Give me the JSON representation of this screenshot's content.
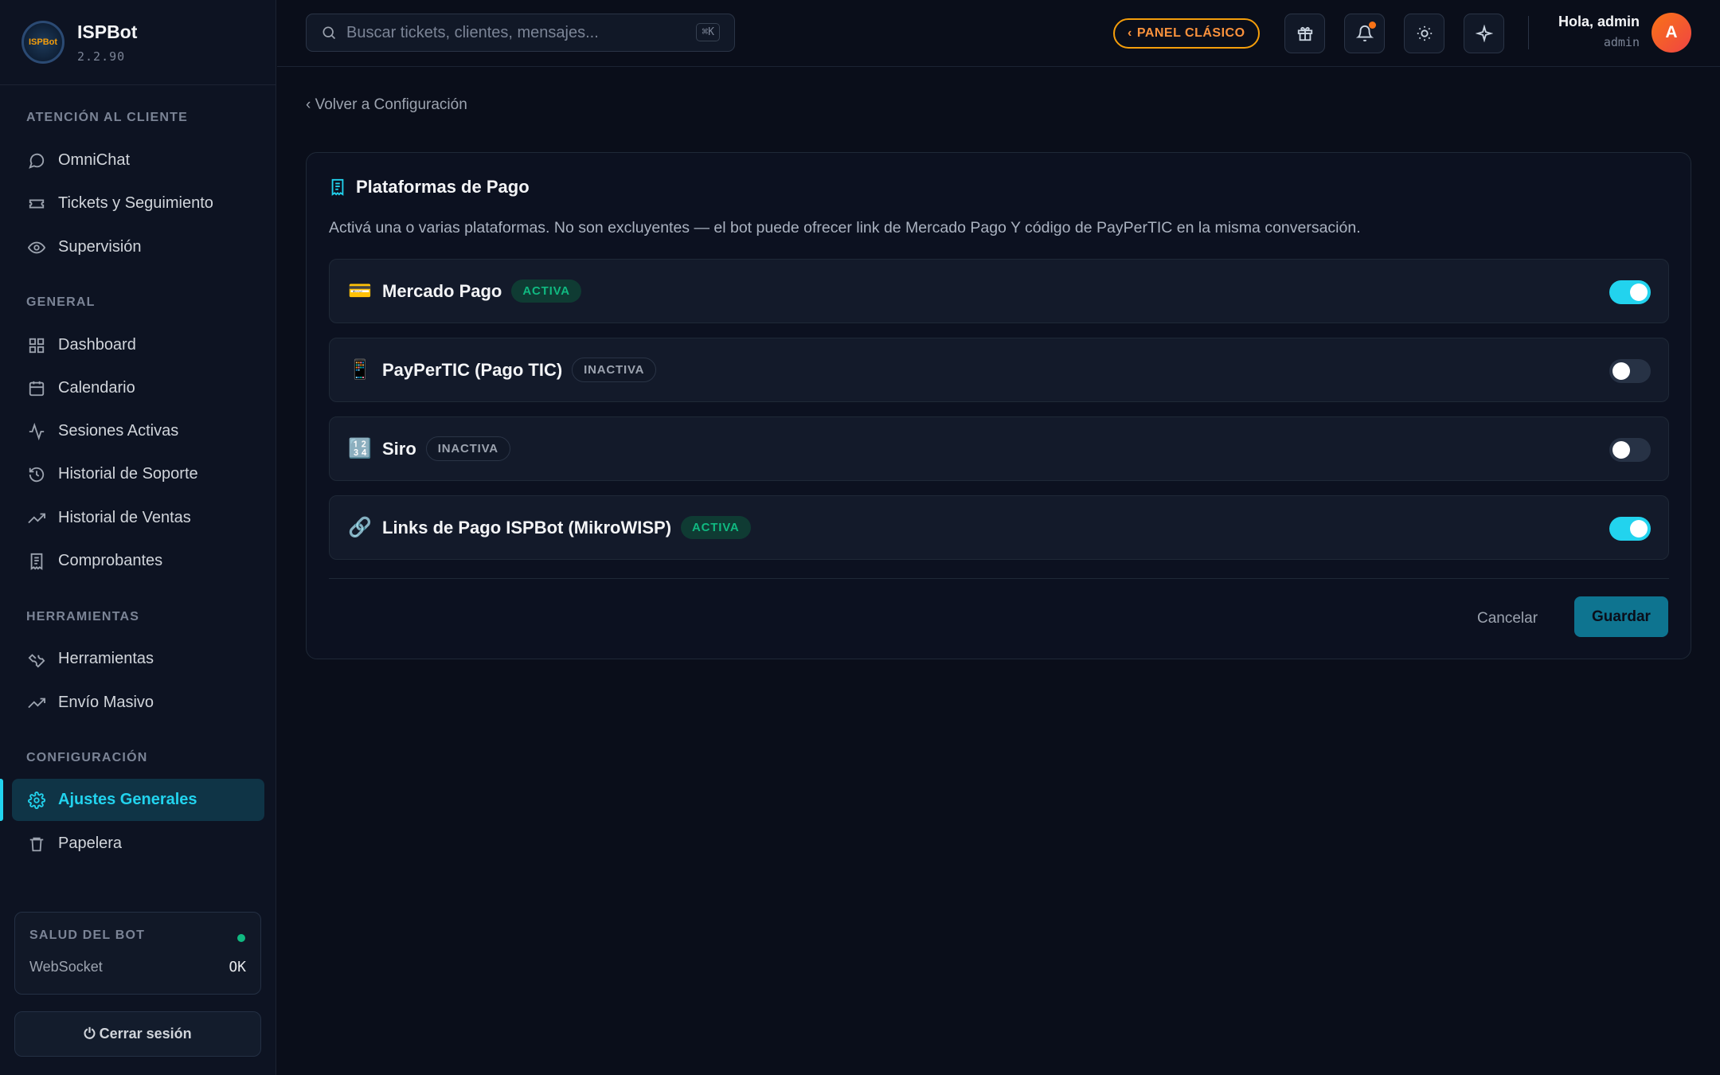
{
  "app": {
    "name": "ISPBot",
    "version": "2.2.90",
    "logo_text": "ISPBot"
  },
  "sidebar": {
    "sections": [
      {
        "title": "ATENCIÓN AL CLIENTE"
      },
      {
        "title": "GENERAL"
      },
      {
        "title": "HERRAMIENTAS"
      },
      {
        "title": "CONFIGURACIÓN"
      }
    ],
    "items": [
      {
        "label": "OmniChat",
        "icon": "chat-bubble-icon"
      },
      {
        "label": "Tickets y Seguimiento",
        "icon": "ticket-icon"
      },
      {
        "label": "Supervisión",
        "icon": "eye-icon"
      },
      {
        "label": "Dashboard",
        "icon": "grid-icon"
      },
      {
        "label": "Calendario",
        "icon": "calendar-icon"
      },
      {
        "label": "Sesiones Activas",
        "icon": "activity-icon"
      },
      {
        "label": "Historial de Soporte",
        "icon": "history-icon"
      },
      {
        "label": "Historial de Ventas",
        "icon": "trending-up-icon"
      },
      {
        "label": "Comprobantes",
        "icon": "receipt-icon"
      },
      {
        "label": "Herramientas",
        "icon": "wrench-icon"
      },
      {
        "label": "Envío Masivo",
        "icon": "trending-up-icon"
      },
      {
        "label": "Ajustes Generales",
        "icon": "gear-icon",
        "active": true
      },
      {
        "label": "Papelera",
        "icon": "trash-icon"
      }
    ],
    "health": {
      "title": "SALUD DEL BOT",
      "label": "WebSocket",
      "value": "OK",
      "status_color": "#10b981"
    },
    "logout": "⏻ Cerrar sesión"
  },
  "header": {
    "search_placeholder": "Buscar tickets, clientes, mensajes...",
    "search_shortcut": "⌘K",
    "classic_panel": "PANEL CLÁSICO",
    "greeting": "Hola, admin",
    "role": "admin",
    "avatar_letter": "A"
  },
  "main": {
    "back_link": "‹ Volver a Configuración",
    "card_title": "Plataformas de Pago",
    "description": "Activá una o varias plataformas. No son excluyentes — el bot puede ofrecer link de Mercado Pago Y código de PayPerTIC en la misma conversación.",
    "platforms": [
      {
        "emoji": "💳",
        "name": "Mercado Pago",
        "status": "ACTIVA",
        "enabled": true
      },
      {
        "emoji": "📱",
        "name": "PayPerTIC (Pago TIC)",
        "status": "INACTIVA",
        "enabled": false
      },
      {
        "emoji": "🔢",
        "name": "Siro",
        "status": "INACTIVA",
        "enabled": false
      },
      {
        "emoji": "🔗",
        "name": "Links de Pago ISPBot (MikroWISP)",
        "status": "ACTIVA",
        "enabled": true
      }
    ],
    "cancel": "Cancelar",
    "save": "Guardar"
  },
  "colors": {
    "accent": "#22d3ee",
    "active_badge": "#10b981",
    "warning": "#f97316"
  }
}
